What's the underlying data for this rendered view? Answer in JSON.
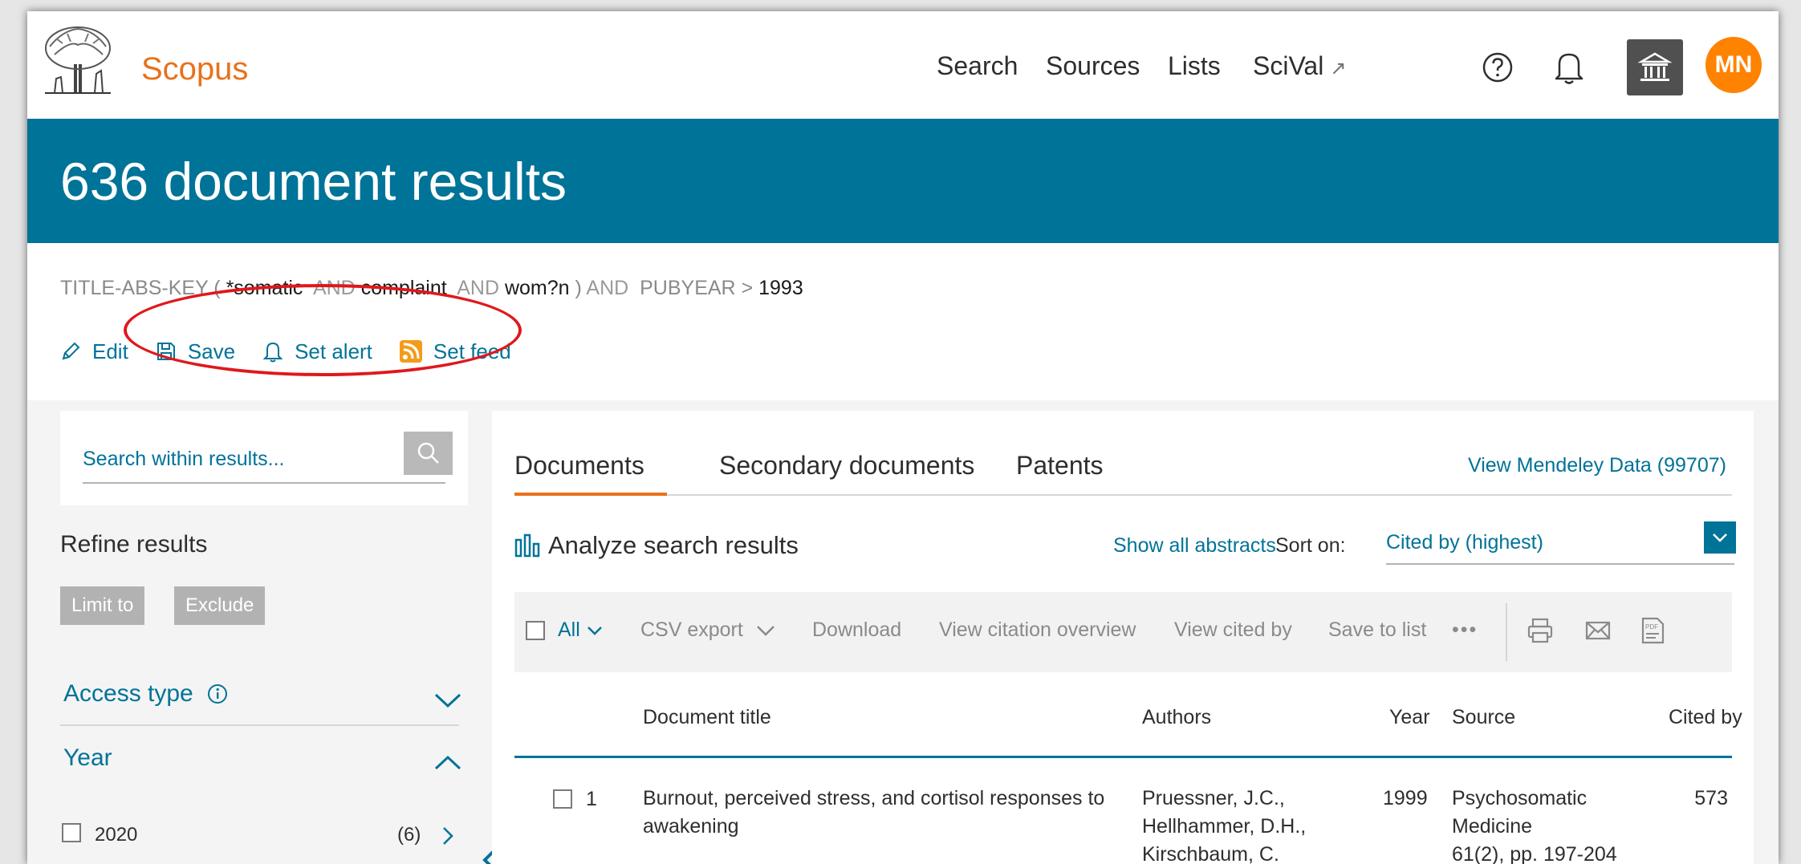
{
  "header": {
    "brand": "Scopus",
    "nav": [
      "Search",
      "Sources",
      "Lists",
      "SciVal"
    ],
    "scival_ext": "↗",
    "avatar_initials": "MN"
  },
  "results": {
    "title": "636 document results"
  },
  "query": {
    "field": "TITLE-ABS-KEY",
    "open": "(",
    "term1": "*somatic",
    "op1": "AND",
    "term2": "complaint",
    "op2": "AND",
    "term3": "wom?n",
    "close": ")",
    "op3": "AND",
    "field2": "PUBYEAR",
    "comparator": ">",
    "year": "1993"
  },
  "actions": {
    "edit": "Edit",
    "save": "Save",
    "set_alert": "Set alert",
    "set_feed": "Set feed"
  },
  "sidebar": {
    "search_placeholder": "Search within results...",
    "refine_title": "Refine results",
    "limit_to": "Limit to",
    "exclude": "Exclude",
    "facets": {
      "access_type": "Access type",
      "year": "Year"
    },
    "year_items": [
      {
        "label": "2020",
        "count": "(6)"
      }
    ]
  },
  "tabs": {
    "documents": "Documents",
    "secondary": "Secondary documents",
    "patents": "Patents"
  },
  "mendeley": "View Mendeley Data (99707)",
  "analyze": "Analyze search results",
  "show_abstracts": "Show all abstracts",
  "sort": {
    "label": "Sort on:",
    "value": "Cited by (highest)"
  },
  "toolbar": {
    "all": "All",
    "csv_export": "CSV export",
    "download": "Download",
    "view_citation_overview": "View citation overview",
    "view_cited_by": "View cited by",
    "save_to_list": "Save to list",
    "more": "•••"
  },
  "table": {
    "headers": {
      "title": "Document title",
      "authors": "Authors",
      "year": "Year",
      "source": "Source",
      "cited_by": "Cited by"
    },
    "rows": [
      {
        "num": "1",
        "title": "Burnout, perceived stress, and cortisol responses to awakening",
        "authors": [
          "Pruessner, J.C.,",
          "Hellhammer, D.H.,",
          "Kirschbaum, C."
        ],
        "year": "1999",
        "source": [
          "Psychosomatic",
          "Medicine",
          "61(2), pp. 197-204"
        ],
        "cited_by": "573"
      }
    ]
  },
  "colors": {
    "brand_orange": "#e9711c",
    "banner_blue": "#007398",
    "link_blue": "#007398",
    "avatar_orange": "#ff8200",
    "annotation_red": "#e0181b"
  }
}
